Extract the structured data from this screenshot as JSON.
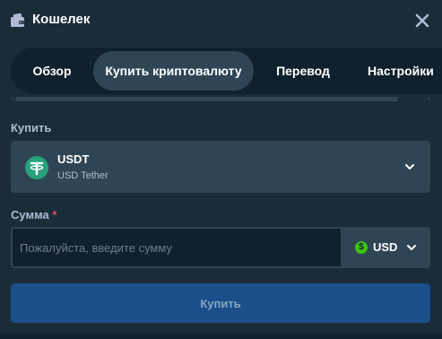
{
  "header": {
    "title": "Кошелек",
    "wallet_icon": "wallet-icon",
    "close_icon": "close-icon"
  },
  "tabs": [
    {
      "label": "Обзор",
      "active": false
    },
    {
      "label": "Купить криптовалюту",
      "active": true
    },
    {
      "label": "Перевод",
      "active": false
    },
    {
      "label": "Настройки",
      "active": false
    }
  ],
  "buy": {
    "label": "Купить",
    "coin_symbol": "USDT",
    "coin_name": "USD Tether",
    "coin_icon": "tether-icon"
  },
  "amount": {
    "label": "Сумма",
    "required_mark": "*",
    "placeholder": "Пожалуйста, введите сумму",
    "value": "",
    "currency": "USD",
    "currency_icon": "dollar-icon"
  },
  "submit": {
    "label": "Купить"
  },
  "colors": {
    "background": "#1a2c38",
    "panel_dark": "#0f212e",
    "panel_light": "#2f4553",
    "muted_text": "#b1bad3",
    "tether_green": "#26a17b",
    "usd_green": "#3bc117",
    "button_blue": "#1b4f8a",
    "required": "#ed4163"
  }
}
